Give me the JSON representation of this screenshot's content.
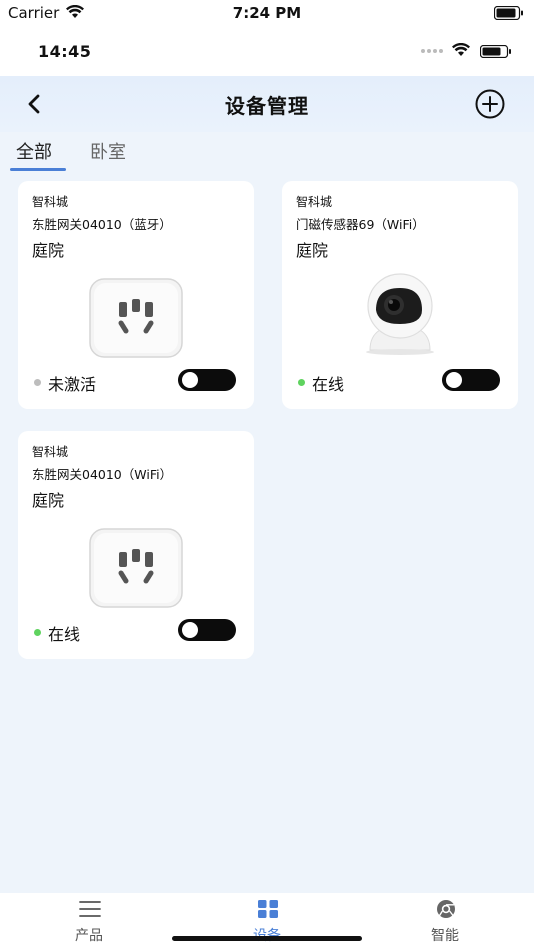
{
  "system_status": {
    "carrier": "Carrier",
    "time": "7:24 PM"
  },
  "inner_status": {
    "time": "14:45"
  },
  "nav": {
    "title": "设备管理",
    "back_icon": "chevron-left-icon",
    "add_icon": "plus-circle-icon"
  },
  "tabs": [
    {
      "label": "全部",
      "selected": true
    },
    {
      "label": "卧室",
      "selected": false
    }
  ],
  "colors": {
    "accent": "#4a7fd6",
    "online": "#5fd35f",
    "inactive": "#bdbdbd",
    "background": "#eef4fb"
  },
  "devices": [
    {
      "brand": "智科城",
      "name": "东胜网关04010（蓝牙）",
      "room": "庭院",
      "status": "未激活",
      "status_color": "#bdbdbd",
      "image": "socket-image",
      "switch_on": false
    },
    {
      "brand": "智科城",
      "name": "门磁传感器69（WiFi）",
      "room": "庭院",
      "status": "在线",
      "status_color": "#5fd35f",
      "image": "camera-image",
      "switch_on": false
    },
    {
      "brand": "智科城",
      "name": "东胜网关04010（WiFi）",
      "room": "庭院",
      "status": "在线",
      "status_color": "#5fd35f",
      "image": "socket-image",
      "switch_on": false
    }
  ],
  "tab_bar": [
    {
      "label": "产品",
      "icon": "list-icon",
      "selected": false
    },
    {
      "label": "设备",
      "icon": "grid-icon",
      "selected": true
    },
    {
      "label": "智能",
      "icon": "chrome-icon",
      "selected": false
    }
  ]
}
